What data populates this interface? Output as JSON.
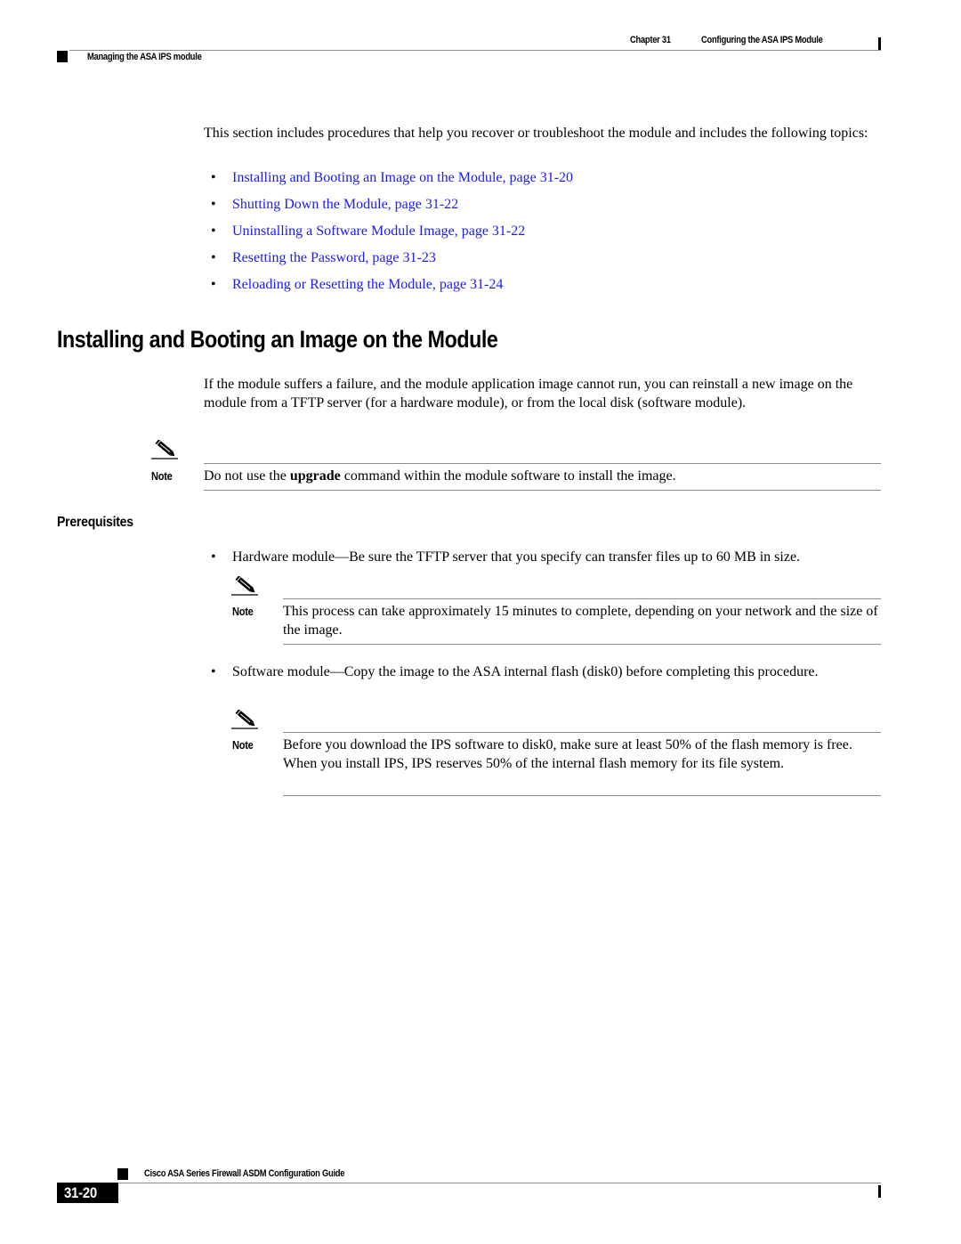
{
  "header": {
    "chapter_label": "Chapter 31",
    "chapter_title": "Configuring the ASA IPS Module",
    "section_title": "Managing the ASA IPS module"
  },
  "intro": {
    "text": "This section includes procedures that help you recover or troubleshoot the module and includes the following topics:"
  },
  "topics": [
    {
      "label": "Installing and Booting an Image on the Module, page 31-20"
    },
    {
      "label": "Shutting Down the Module, page 31-22"
    },
    {
      "label": "Uninstalling a Software Module Image, page 31-22"
    },
    {
      "label": "Resetting the Password, page 31-23"
    },
    {
      "label": "Reloading or Resetting the Module, page 31-24"
    }
  ],
  "bullet_glyph": "•",
  "section": {
    "heading": "Installing and Booting an Image on the Module",
    "paragraph": "If the module suffers a failure, and the module application image cannot run, you can reinstall a new image on the module from a TFTP server (for a hardware module), or from the local disk (software module).",
    "note1": {
      "label": "Note",
      "text_before": "Do not use the ",
      "text_bold": "upgrade",
      "text_after": " command within the module software to install the image."
    },
    "prerequisites_heading": "Prerequisites",
    "prereq_items": [
      {
        "text": "Hardware module—Be sure the TFTP server that you specify can transfer files up to 60 MB in size.",
        "note": {
          "label": "Note",
          "text": "This process can take approximately 15 minutes to complete, depending on your network and the size of the image."
        }
      },
      {
        "text": "Software module—Copy the image to the ASA internal flash (disk0) before completing this procedure.",
        "note": {
          "label": "Note",
          "text": "Before you download the IPS software to disk0, make sure at least 50% of the flash memory is free. When you install IPS, IPS reserves 50% of the internal flash memory for its file system."
        }
      }
    ]
  },
  "footer": {
    "guide_title": "Cisco ASA Series Firewall ASDM Configuration Guide",
    "page_number": "31-20"
  },
  "icons": {
    "note": "pencil-note-icon"
  }
}
